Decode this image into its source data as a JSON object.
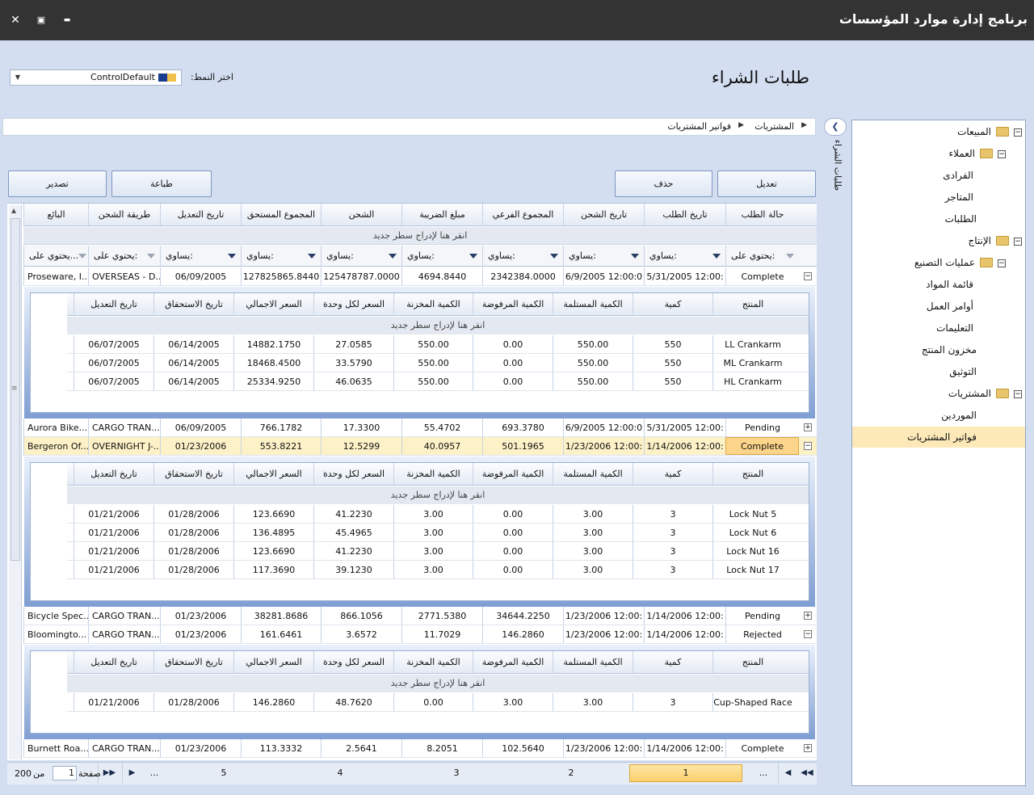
{
  "window": {
    "title": "برنامج إدارة موارد المؤسسات",
    "close": "✕",
    "maximize": "▣",
    "minimize": "▬"
  },
  "header": {
    "page_title": "طلبات الشراء",
    "style_label": "اختر النمط:",
    "style_value": "ControlDefault"
  },
  "breadcrumb": {
    "root": "المشتريات",
    "current": "فواتير المشتريات"
  },
  "side_panel": {
    "vertical_title": "طلبات الشراء",
    "collapse_glyph": "❮"
  },
  "tree": [
    {
      "label": "المبيعات",
      "level": 0,
      "folder": true,
      "expander": "⊟"
    },
    {
      "label": "العملاء",
      "level": 1,
      "folder": true,
      "expander": "⊟"
    },
    {
      "label": "الفرادى",
      "level": 2
    },
    {
      "label": "المتاجر",
      "level": 2
    },
    {
      "label": "الطلبات",
      "level": 1
    },
    {
      "label": "الإنتاج",
      "level": 0,
      "folder": true,
      "expander": "⊟"
    },
    {
      "label": "عمليات التصنيع",
      "level": 1,
      "folder": true,
      "expander": "⊟"
    },
    {
      "label": "قائمة المواد",
      "level": 2
    },
    {
      "label": "أوامر العمل",
      "level": 2
    },
    {
      "label": "التعليمات",
      "level": 2
    },
    {
      "label": "مخزون المنتج",
      "level": 1
    },
    {
      "label": "التوثيق",
      "level": 1
    },
    {
      "label": "المشتريات",
      "level": 0,
      "folder": true,
      "expander": "⊟"
    },
    {
      "label": "الموردين",
      "level": 1
    },
    {
      "label": "فواتير المشتريات",
      "level": 1,
      "selected": true
    }
  ],
  "toolbar": {
    "edit": "تعديل",
    "delete": "حذف",
    "print": "طباعة",
    "export": "تصدير"
  },
  "grid": {
    "columns": [
      "حالة الطلب",
      "تاريخ الطلب",
      "تاريخ الشحن",
      "المجموع الفرعي",
      "مبلغ الضريبة",
      "الشحن",
      "المجموع المستحق",
      "تاريخ التعديل",
      "طريقة الشحن",
      "البائع"
    ],
    "new_row_text": "انقر هنا لإدراج سطر جديد",
    "filters": [
      "يحتوي على:",
      "يساوي:",
      "يساوي:",
      "يساوي:",
      "يساوي:",
      "يساوي:",
      "يساوي:",
      "يساوي:",
      "يحتوي على:",
      "يحتوي على..."
    ],
    "detail_columns": [
      "المنتج",
      "كمية",
      "الكمية المستلمة",
      "الكمية المرفوضة",
      "الكمية المخزنة",
      "السعر لكل وحدة",
      "السعر الاجمالي",
      "تاريخ الاستحقاق",
      "تاريخ التعديل"
    ],
    "rows": [
      {
        "cells": [
          "Complete",
          "5/31/2005 12:00:",
          "6/9/2005 12:00:0",
          "2342384.0000",
          "4694.8440",
          "125478787.0000",
          "127825865.8440",
          "06/09/2005",
          "OVERSEAS - D...",
          "Proseware, I..."
        ],
        "expanded": true,
        "details": [
          [
            "LL Crankarm",
            "550",
            "550.00",
            "0.00",
            "550.00",
            "27.0585",
            "14882.1750",
            "06/14/2005",
            "06/07/2005"
          ],
          [
            "ML Crankarm",
            "550",
            "550.00",
            "0.00",
            "550.00",
            "33.5790",
            "18468.4500",
            "06/14/2005",
            "06/07/2005"
          ],
          [
            "HL Crankarm",
            "550",
            "550.00",
            "0.00",
            "550.00",
            "46.0635",
            "25334.9250",
            "06/14/2005",
            "06/07/2005"
          ]
        ]
      },
      {
        "cells": [
          "Pending",
          "5/31/2005 12:00:",
          "6/9/2005 12:00:0",
          "693.3780",
          "55.4702",
          "17.3300",
          "766.1782",
          "06/09/2005",
          "CARGO TRAN...",
          "Aurora Bike..."
        ],
        "expanded": false
      },
      {
        "cells": [
          "Complete",
          "1/14/2006 12:00:",
          "1/23/2006 12:00:",
          "501.1965",
          "40.0957",
          "12.5299",
          "553.8221",
          "01/23/2006",
          "OVERNIGHT J-...",
          "Bergeron Of..."
        ],
        "expanded": true,
        "selected": true,
        "details": [
          [
            "Lock Nut 5",
            "3",
            "3.00",
            "0.00",
            "3.00",
            "41.2230",
            "123.6690",
            "01/28/2006",
            "01/21/2006"
          ],
          [
            "Lock Nut 6",
            "3",
            "3.00",
            "0.00",
            "3.00",
            "45.4965",
            "136.4895",
            "01/28/2006",
            "01/21/2006"
          ],
          [
            "Lock Nut 16",
            "3",
            "3.00",
            "0.00",
            "3.00",
            "41.2230",
            "123.6690",
            "01/28/2006",
            "01/21/2006"
          ],
          [
            "Lock Nut 17",
            "3",
            "3.00",
            "0.00",
            "3.00",
            "39.1230",
            "117.3690",
            "01/28/2006",
            "01/21/2006"
          ]
        ]
      },
      {
        "cells": [
          "Pending",
          "1/14/2006 12:00:",
          "1/23/2006 12:00:",
          "34644.2250",
          "2771.5380",
          "866.1056",
          "38281.8686",
          "01/23/2006",
          "CARGO TRAN...",
          "Bicycle Spec..."
        ],
        "expanded": false
      },
      {
        "cells": [
          "Rejected",
          "1/14/2006 12:00:",
          "1/23/2006 12:00:",
          "146.2860",
          "11.7029",
          "3.6572",
          "161.6461",
          "01/23/2006",
          "CARGO TRAN...",
          "Bloomingto..."
        ],
        "expanded": true,
        "details": [
          [
            "Cup-Shaped Race",
            "3",
            "3.00",
            "3.00",
            "0.00",
            "48.7620",
            "146.2860",
            "01/28/2006",
            "01/21/2006"
          ]
        ]
      },
      {
        "cells": [
          "Complete",
          "1/14/2006 12:00:",
          "1/23/2006 12:00:",
          "102.5640",
          "8.2051",
          "2.5641",
          "113.3332",
          "01/23/2006",
          "CARGO TRAN...",
          "Burnett Roa..."
        ],
        "expanded": false
      }
    ]
  },
  "pager": {
    "pages": [
      "1",
      "2",
      "3",
      "4",
      "5"
    ],
    "ellipsis": "...",
    "page_label": "صفحة",
    "current_page": "1",
    "of_label": "من",
    "total_pages": "200"
  }
}
